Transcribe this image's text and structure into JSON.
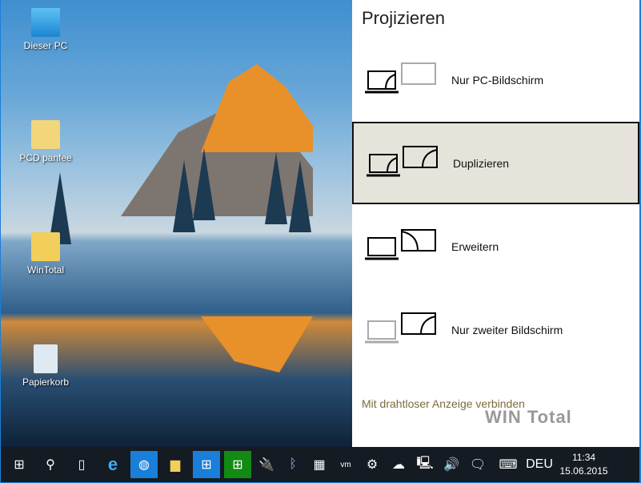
{
  "desktop": {
    "icons": [
      {
        "label": "Dieser PC",
        "icon": "computer-icon"
      },
      {
        "label": "PCD panfee",
        "icon": "user-folder-icon"
      },
      {
        "label": "WinTotal",
        "icon": "folder-icon"
      },
      {
        "label": "Papierkorb",
        "icon": "recycle-bin-icon"
      }
    ]
  },
  "panel": {
    "title": "Projizieren",
    "options": [
      {
        "label": "Nur PC-Bildschirm",
        "selected": false
      },
      {
        "label": "Duplizieren",
        "selected": true
      },
      {
        "label": "Erweitern",
        "selected": false
      },
      {
        "label": "Nur zweiter Bildschirm",
        "selected": false
      }
    ],
    "wireless_link": "Mit drahtloser Anzeige verbinden",
    "watermark": "WIN Total"
  },
  "taskbar": {
    "language": "DEU",
    "time": "11:34",
    "date": "15.06.2015"
  },
  "colors": {
    "accent": "#1a7fd8",
    "selected_bg": "#e6e3db",
    "link": "#7d6b3e",
    "taskbar": "#151b22"
  }
}
